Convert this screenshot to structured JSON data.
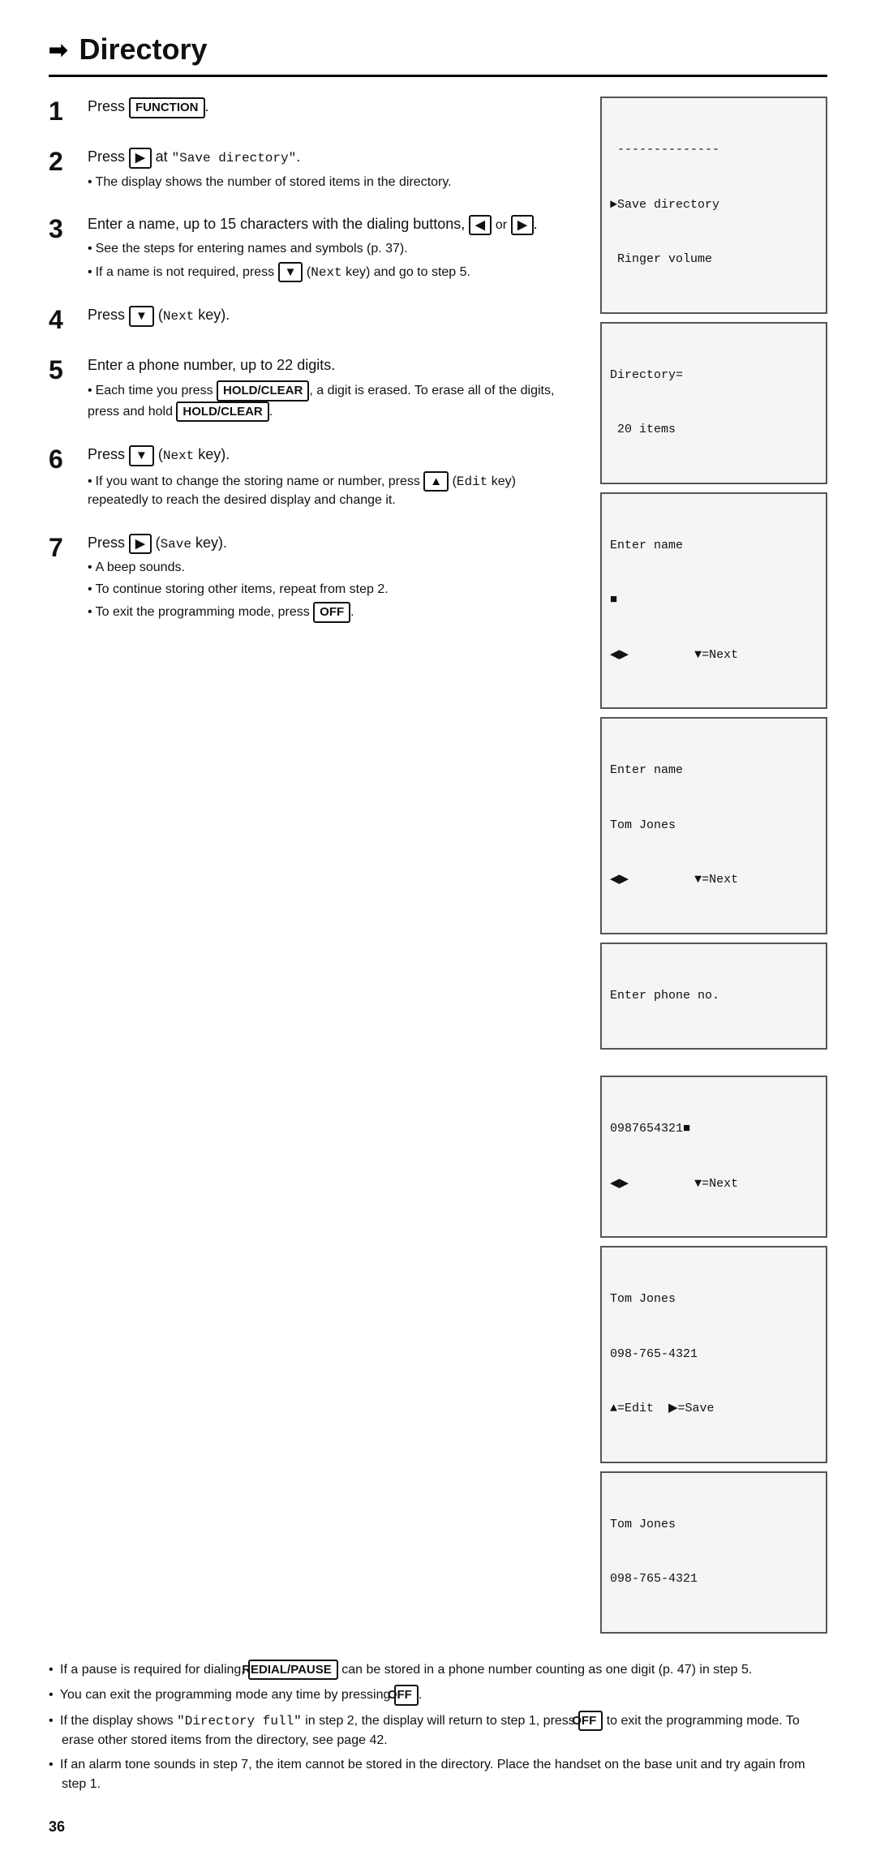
{
  "page": {
    "title": "Directory",
    "page_number": "36"
  },
  "steps": [
    {
      "num": "1",
      "main": "Press [FUNCTION].",
      "bullets": []
    },
    {
      "num": "2",
      "main": "Press [right] at \"Save directory\".",
      "bullets": [
        "The display shows the number of stored items in the directory."
      ]
    },
    {
      "num": "3",
      "main": "Enter a name, up to 15 characters with the dialing buttons, [left] or [right].",
      "bullets": [
        "See the steps for entering names and symbols (p. 37).",
        "If a name is not required, press [down] (Next key) and go to step 5."
      ]
    },
    {
      "num": "4",
      "main": "Press [down] (Next key).",
      "bullets": []
    },
    {
      "num": "5",
      "main": "Enter a phone number, up to 22 digits.",
      "bullets": [
        "Each time you press [HOLD/CLEAR], a digit is erased. To erase all of the digits, press and hold [HOLD/CLEAR]."
      ]
    },
    {
      "num": "6",
      "main": "Press [down] (Next key).",
      "bullets": [
        "If you want to change the storing name or number, press [up] (Edit key) repeatedly to reach the desired display and change it."
      ]
    },
    {
      "num": "7",
      "main": "Press [right] (Save key).",
      "bullets": [
        "A beep sounds.",
        "To continue storing other items, repeat from step 2.",
        "To exit the programming mode, press [OFF]."
      ]
    }
  ],
  "displays": [
    {
      "id": "disp1",
      "lines": [
        "  --------------",
        "►Save directory",
        " Ringer volume"
      ]
    },
    {
      "id": "disp2",
      "lines": [
        "Directory=",
        " 20 items"
      ]
    },
    {
      "id": "disp3",
      "lines": [
        "Enter name",
        "■",
        "◄►          ▼=Next"
      ]
    },
    {
      "id": "disp4",
      "lines": [
        "Enter name",
        "Tom Jones",
        "◄►          ▼=Next"
      ]
    },
    {
      "id": "disp5",
      "lines": [
        "Enter phone no."
      ]
    },
    {
      "id": "disp6",
      "lines": [
        "0987654321■",
        "◄►          ▼=Next"
      ]
    },
    {
      "id": "disp7",
      "lines": [
        "Tom Jones",
        "098-765-4321",
        "▲=Edit   ►=Save"
      ]
    },
    {
      "id": "disp8",
      "lines": [
        "Tom Jones",
        "098-765-4321"
      ]
    }
  ],
  "bottom_notes": [
    "If a pause is required for dialing, [REDIAL/PAUSE] can be stored in a phone number counting as one digit (p. 47) in step 5.",
    "You can exit the programming mode any time by pressing [OFF].",
    "If the display shows \"Directory full\" in step 2, the display will return to step 1, press [OFF] to exit the programming mode. To erase other stored items from the directory, see page 42.",
    "If an alarm tone sounds in step 7, the item cannot be stored in the directory. Place the handset on the base unit and try again from step 1."
  ]
}
